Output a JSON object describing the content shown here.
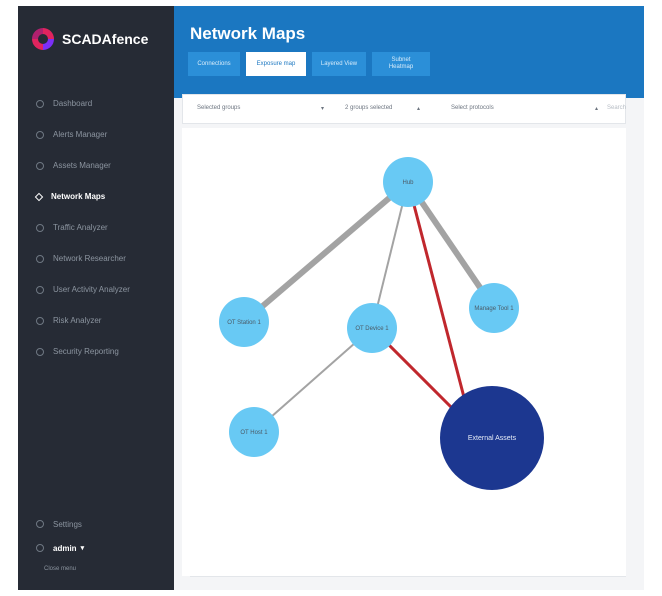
{
  "brand": {
    "name": "SCADAfence"
  },
  "sidebar": {
    "items": [
      {
        "label": "Dashboard",
        "icon": "dashboard-icon"
      },
      {
        "label": "Alerts Manager",
        "icon": "alerts-icon"
      },
      {
        "label": "Assets Manager",
        "icon": "assets-icon"
      },
      {
        "label": "Network Maps",
        "icon": "network-icon",
        "active": true
      },
      {
        "label": "Traffic Analyzer",
        "icon": "traffic-icon"
      },
      {
        "label": "Network Researcher",
        "icon": "research-icon"
      },
      {
        "label": "User Activity Analyzer",
        "icon": "user-activity-icon"
      },
      {
        "label": "Risk Analyzer",
        "icon": "risk-icon"
      },
      {
        "label": "Security Reporting",
        "icon": "report-icon"
      }
    ],
    "settings_label": "Settings",
    "user_label": "admin",
    "close_label": "Close menu"
  },
  "header": {
    "title": "Network Maps",
    "tabs": [
      {
        "label": "Connections"
      },
      {
        "label": "Exposure map"
      },
      {
        "label": "Layered View"
      },
      {
        "label": "Subnet Heatmap"
      }
    ]
  },
  "filters": {
    "group_select": "Selected groups",
    "groups_selected": "2 groups selected",
    "protocols": "Select protocols",
    "search_placeholder": "Search"
  },
  "colors": {
    "header": "#1b77c1",
    "sidebar": "#262b35",
    "node": "#68c9f4",
    "external_node": "#1c3790",
    "link_gray": "#9e9e9e",
    "link_red": "#c0272d"
  },
  "map": {
    "nodes": [
      {
        "id": "hub",
        "label": "Hub"
      },
      {
        "id": "ot-station",
        "label": "OT Station 1"
      },
      {
        "id": "ot-device",
        "label": "OT Device 1"
      },
      {
        "id": "manage",
        "label": "Manage Tool 1"
      },
      {
        "id": "ot-host",
        "label": "OT Host 1"
      },
      {
        "id": "external",
        "label": "External Assets"
      }
    ]
  }
}
